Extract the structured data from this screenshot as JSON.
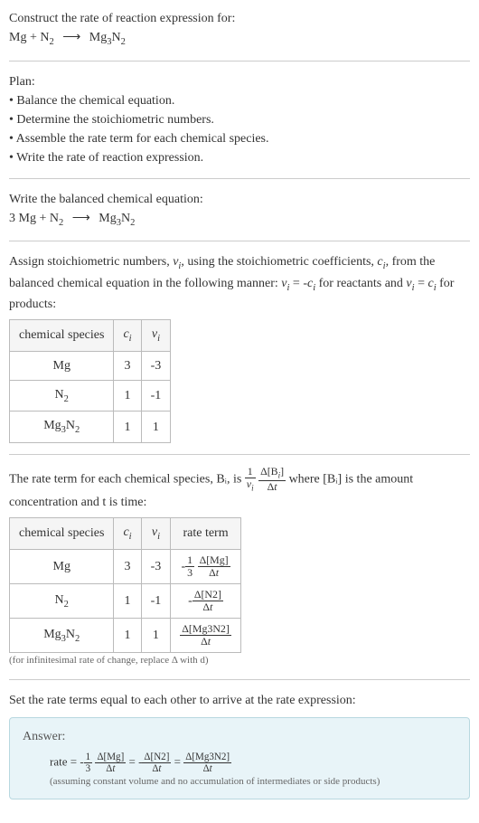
{
  "header": {
    "prompt": "Construct the rate of reaction expression for:",
    "equation": "Mg + N₂ ⟶ Mg₃N₂"
  },
  "plan": {
    "title": "Plan:",
    "b1": "• Balance the chemical equation.",
    "b2": "• Determine the stoichiometric numbers.",
    "b3": "• Assemble the rate term for each chemical species.",
    "b4": "• Write the rate of reaction expression."
  },
  "balanced": {
    "intro": "Write the balanced chemical equation:",
    "equation": "3 Mg + N₂ ⟶ Mg₃N₂"
  },
  "assign": {
    "text": "Assign stoichiometric numbers, νᵢ, using the stoichiometric coefficients, cᵢ, from the balanced chemical equation in the following manner: νᵢ = -cᵢ for reactants and νᵢ = cᵢ for products:",
    "h1": "chemical species",
    "h2": "cᵢ",
    "h3": "νᵢ",
    "rows": [
      {
        "s": "Mg",
        "c": "3",
        "v": "-3"
      },
      {
        "s": "N₂",
        "c": "1",
        "v": "-1"
      },
      {
        "s": "Mg₃N₂",
        "c": "1",
        "v": "1"
      }
    ]
  },
  "rateterm": {
    "text_a": "The rate term for each chemical species, Bᵢ, is ",
    "text_b": " where [Bᵢ] is the amount concentration and t is time:",
    "h1": "chemical species",
    "h2": "cᵢ",
    "h3": "νᵢ",
    "h4": "rate term",
    "rows": [
      {
        "s": "Mg",
        "c": "3",
        "v": "-3"
      },
      {
        "s": "N₂",
        "c": "1",
        "v": "-1"
      },
      {
        "s": "Mg₃N₂",
        "c": "1",
        "v": "1"
      }
    ],
    "note": "(for infinitesimal rate of change, replace Δ with d)"
  },
  "final": {
    "intro": "Set the rate terms equal to each other to arrive at the rate expression:",
    "answer_label": "Answer:",
    "assume": "(assuming constant volume and no accumulation of intermediates or side products)"
  },
  "chart_data": {
    "type": "table",
    "title": "Stoichiometric numbers and rate terms",
    "series": [
      {
        "name": "Mg",
        "values": {
          "c_i": 3,
          "nu_i": -3,
          "rate_term": "-(1/3) Δ[Mg]/Δt"
        }
      },
      {
        "name": "N2",
        "values": {
          "c_i": 1,
          "nu_i": -1,
          "rate_term": "-Δ[N2]/Δt"
        }
      },
      {
        "name": "Mg3N2",
        "values": {
          "c_i": 1,
          "nu_i": 1,
          "rate_term": "Δ[Mg3N2]/Δt"
        }
      }
    ],
    "rate_expression": "rate = -(1/3) Δ[Mg]/Δt = -Δ[N2]/Δt = Δ[Mg3N2]/Δt"
  }
}
